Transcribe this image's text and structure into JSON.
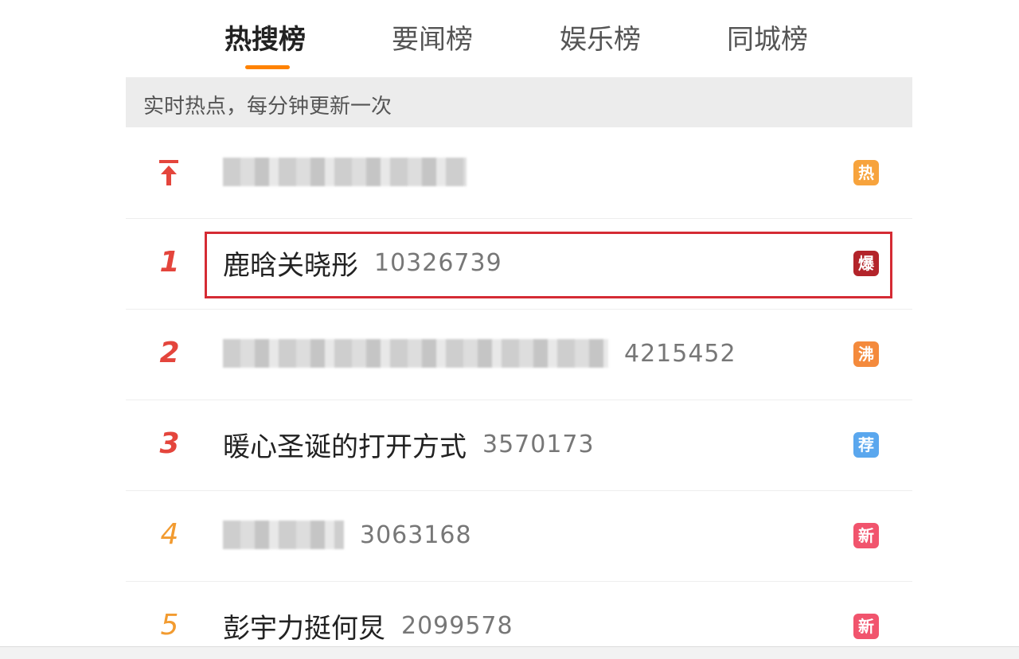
{
  "tabs": [
    {
      "label": "热搜榜",
      "active": true
    },
    {
      "label": "要闻榜",
      "active": false
    },
    {
      "label": "娱乐榜",
      "active": false
    },
    {
      "label": "同城榜",
      "active": false
    }
  ],
  "info_bar": {
    "text": "实时热点，每分钟更新一次"
  },
  "rows": [
    {
      "rank": "",
      "icon": "pin-top-icon",
      "title": "",
      "count": "",
      "blurred": true,
      "badge": {
        "label": "热",
        "color": "#f7a33c"
      }
    },
    {
      "rank": "1",
      "title": "鹿晗关晓彤",
      "count": "10326739",
      "blurred": false,
      "badge": {
        "label": "爆",
        "color": "#b3242a"
      }
    },
    {
      "rank": "2",
      "title": "",
      "count": "4215452",
      "blurred": true,
      "badge": {
        "label": "沸",
        "color": "#f48a3c"
      }
    },
    {
      "rank": "3",
      "title": "暖心圣诞的打开方式",
      "count": "3570173",
      "blurred": false,
      "badge": {
        "label": "荐",
        "color": "#5aa7ee"
      }
    },
    {
      "rank": "4",
      "title": "",
      "count": "3063168",
      "blurred": true,
      "badge": {
        "label": "新",
        "color": "#f1546d"
      }
    },
    {
      "rank": "5",
      "title": "彭宇力挺何炅",
      "count": "2099578",
      "blurred": false,
      "badge": {
        "label": "新",
        "color": "#f1546d"
      }
    }
  ],
  "colors": {
    "accent": "#ff8200",
    "highlight": "#d52b34",
    "rank_top": "#e4453c",
    "rank_other": "#f29b30"
  }
}
